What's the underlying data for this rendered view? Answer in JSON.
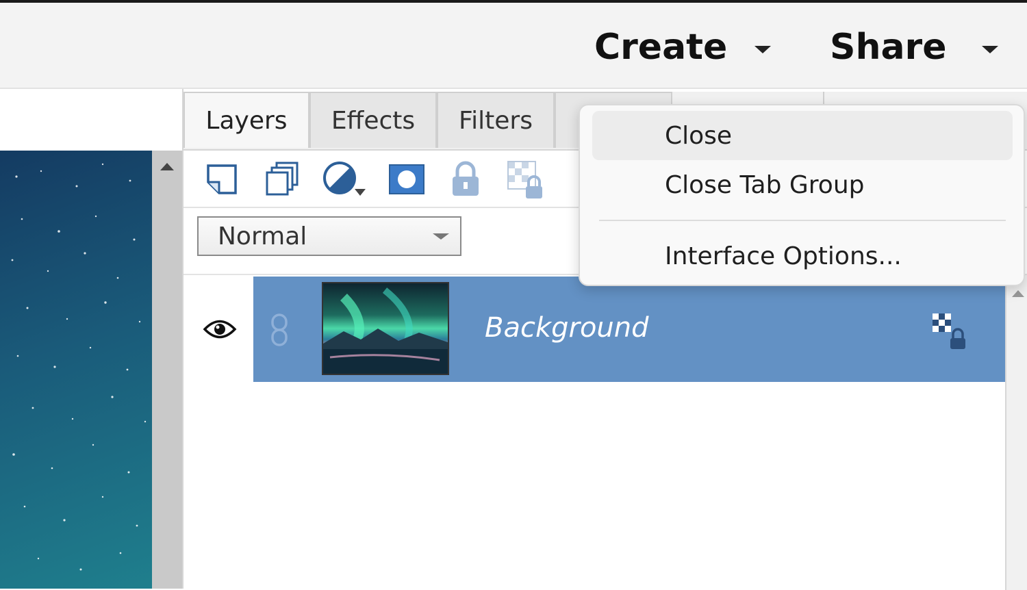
{
  "topbar": {
    "create_label": "Create",
    "share_label": "Share"
  },
  "panel": {
    "tabs": [
      {
        "label": "Layers",
        "active": true
      },
      {
        "label": "Effects",
        "active": false
      },
      {
        "label": "Filters",
        "active": false
      }
    ],
    "toolbar_icons": [
      "new-layer-icon",
      "new-layer-group-icon",
      "adjustment-layer-icon",
      "layer-mask-icon",
      "lock-all-icon",
      "lock-transparency-icon"
    ],
    "blend_mode": "Normal",
    "layers": [
      {
        "name": "Background",
        "visible": true,
        "selected": true
      }
    ],
    "colors": {
      "selected_row": "#6391c4"
    }
  },
  "context_menu": {
    "items": [
      {
        "label": "Close"
      },
      {
        "label": "Close Tab Group"
      },
      {
        "label": "Interface Options..."
      }
    ]
  }
}
